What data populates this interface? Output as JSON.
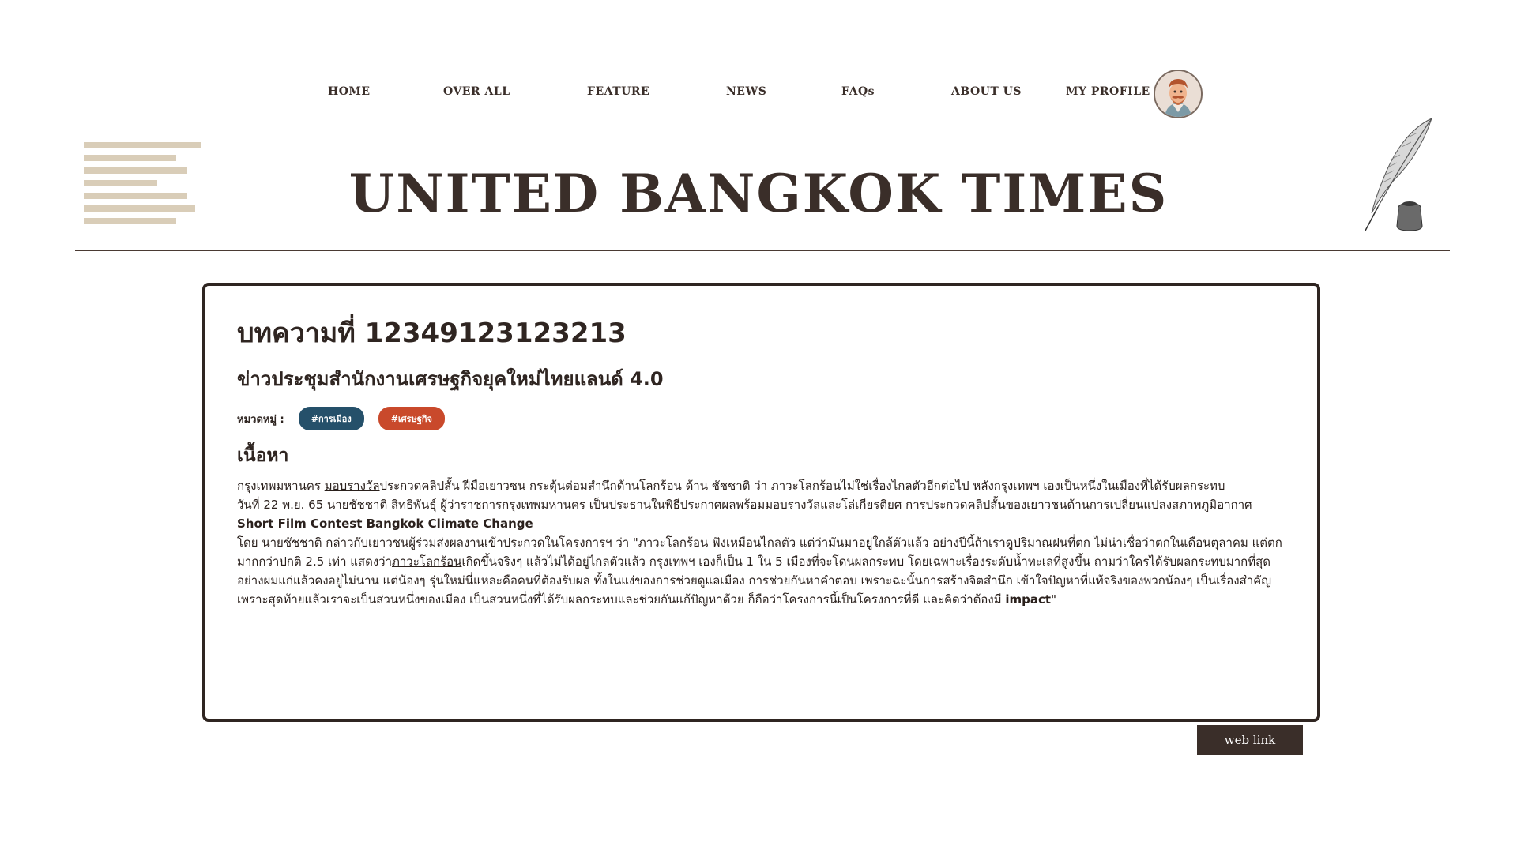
{
  "nav": {
    "items": [
      {
        "label": "HOME"
      },
      {
        "label": "OVER ALL"
      },
      {
        "label": "FEATURE"
      },
      {
        "label": "NEWS"
      },
      {
        "label": "FAQs"
      },
      {
        "label": "ABOUT US"
      },
      {
        "label": "MY PROFILE"
      }
    ],
    "avatar_icon": "user-avatar-icon"
  },
  "masthead": {
    "title": "UNITED BANGKOK TIMES"
  },
  "colors": {
    "ink": "#2f2521",
    "accent_dark": "#3a2e29",
    "deco_lines": "#d9cdb8",
    "tag_politics": "#25506a",
    "tag_economy": "#c9492b"
  },
  "article": {
    "number": "บทความที่ 12349123123213",
    "title": "ข่าวประชุมสำนักงานเศรษฐกิจยุคใหม่ไทยแลนด์ 4.0",
    "category_label": "หมวดหมู่ :",
    "tags": [
      "#การเมือง",
      "#เศรษฐกิจ"
    ],
    "content_heading": "เนื้อหา",
    "body": {
      "p1_a": "กรุงเทพมหานคร ",
      "p1_link": "มอบรางวัล",
      "p1_b": "ประกวดคลิปสั้น ฝีมือเยาวชน กระตุ้นต่อมสำนึกด้านโลกร้อน ด้าน ชัชชาติ ว่า ภาวะโลกร้อนไม่ใช่เรื่องไกลตัวอีกต่อไป หลังกรุงเทพฯ เองเป็นหนึ่งในเมืองที่ได้รับผลกระทบ",
      "p2_a": "วันที่ 22 พ.ย. 65 นายชัชชาติ สิทธิพันธุ์ ผู้ว่าราชการกรุงเทพมหานคร เป็นประธานในพิธีประกาศผลพร้อมมอบรางวัลและโล่เกียรติยศ การประกวดคลิปสั้นของเยาวชนด้านการเปลี่ยนแปลงสภาพภูมิอากาศ ",
      "p2_en": "Short Film Contest Bangkok Climate Change",
      "p3_a": "โดย นายชัชชาติ กล่าวกับเยาวชนผู้ร่วมส่งผลงานเข้าประกวดในโครงการฯ ว่า \"ภาวะโลกร้อน ฟังเหมือนไกลตัว แต่ว่ามันมาอยู่ใกล้ตัวแล้ว อย่างปีนี้ถ้าเราดูปริมาณฝนที่ตก ไม่น่าเชื่อว่าตกในเดือนตุลาคม แต่ตกมากกว่าปกติ 2.5 เท่า แสดงว่า",
      "p3_link": "ภาวะโลกร้อน",
      "p3_b": "เกิดขึ้นจริงๆ แล้วไม่ได้อยู่ไกลตัวแล้ว กรุงเทพฯ เองก็เป็น 1 ใน 5 เมืองที่จะโดนผลกระทบ โดยเฉพาะเรื่องระดับน้ำทะเลที่สูงขึ้น ถามว่าใครได้รับผลกระทบมากที่สุด อย่างผมแก่แล้วคงอยู่ไม่นาน แต่น้องๆ รุ่นใหม่นี่แหละคือคนที่ต้องรับผล ทั้งในแง่ของการช่วยดูแลเมือง การช่วยกันหาคำตอบ เพราะฉะนั้นการสร้างจิตสำนึก เข้าใจปัญหาที่แท้จริงของพวกน้องๆ เป็นเรื่องสำคัญ เพราะสุดท้ายแล้วเราจะเป็นส่วนหนึ่งของเมือง เป็นส่วนหนึ่งที่ได้รับผลกระทบและช่วยกันแก้ปัญหาด้วย ก็ถือว่าโครงการนี้เป็นโครงการที่ดี และคิดว่าต้องมี ",
      "p3_en": "impact",
      "p3_end": "\""
    }
  },
  "footer": {
    "web_link_label": "web link"
  }
}
